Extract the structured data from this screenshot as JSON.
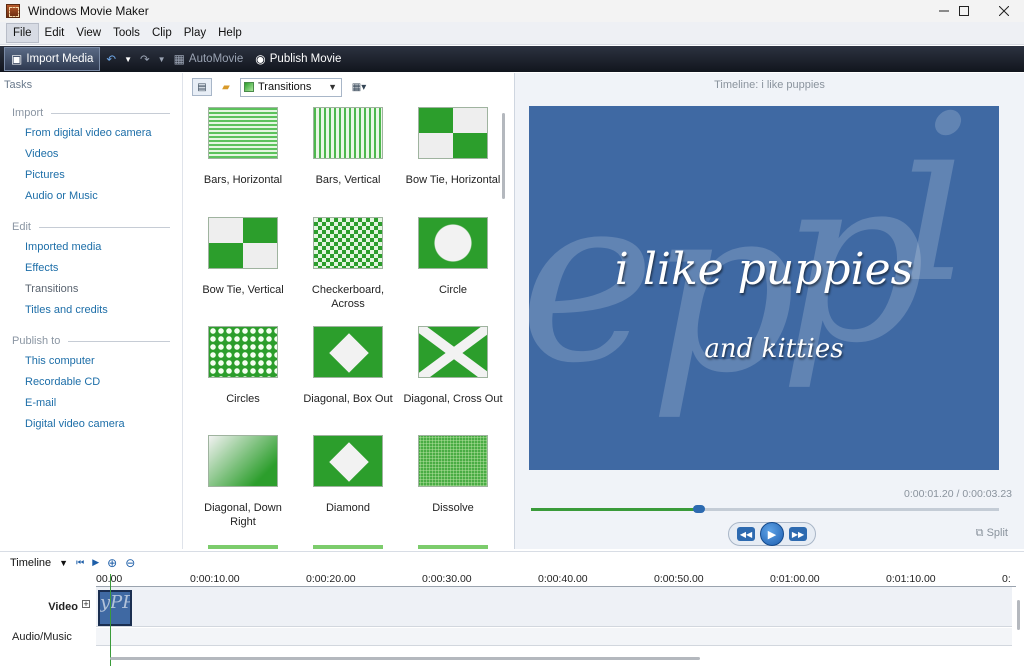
{
  "window": {
    "title": "Windows Movie Maker",
    "controls": [
      "minimize",
      "maximize",
      "close"
    ]
  },
  "menubar": {
    "items": [
      "File",
      "Edit",
      "View",
      "Tools",
      "Clip",
      "Play",
      "Help"
    ],
    "active": "File"
  },
  "toolbar": {
    "import_media": "Import Media",
    "automovie": "AutoMovie",
    "publish_movie": "Publish Movie"
  },
  "tasks": {
    "header": "Tasks",
    "sections": [
      {
        "title": "Import",
        "items": [
          "From digital video camera",
          "Videos",
          "Pictures",
          "Audio or Music"
        ]
      },
      {
        "title": "Edit",
        "items": [
          "Imported media",
          "Effects",
          "Transitions",
          "Titles and credits"
        ]
      },
      {
        "title": "Publish to",
        "items": [
          "This computer",
          "Recordable CD",
          "E-mail",
          "Digital video camera"
        ]
      }
    ],
    "current_item": "Transitions"
  },
  "gallery": {
    "dropdown_value": "Transitions",
    "tiles": [
      {
        "label": "Bars, Horizontal",
        "pattern": "bars-h"
      },
      {
        "label": "Bars, Vertical",
        "pattern": "bars-v"
      },
      {
        "label": "Bow Tie, Horizontal",
        "pattern": "bowtie-h"
      },
      {
        "label": "Bow Tie, Vertical",
        "pattern": "bowtie-v"
      },
      {
        "label": "Checkerboard, Across",
        "pattern": "checker"
      },
      {
        "label": "Circle",
        "pattern": "circle"
      },
      {
        "label": "Circles",
        "pattern": "circles"
      },
      {
        "label": "Diagonal, Box Out",
        "pattern": "box-out"
      },
      {
        "label": "Diagonal, Cross Out",
        "pattern": "cross-out"
      },
      {
        "label": "Diagonal, Down Right",
        "pattern": "down-right"
      },
      {
        "label": "Diamond",
        "pattern": "diamond"
      },
      {
        "label": "Dissolve",
        "pattern": "dissolve"
      }
    ]
  },
  "preview": {
    "title": "Timeline: i like puppies",
    "caption_main": "i like puppies",
    "caption_sub": "and kitties",
    "background_text": "eppi",
    "time_readout": "0:00:01.20 / 0:00:03.23",
    "position_fraction": 0.36,
    "split_label": "Split",
    "video_color": "#3f69a3"
  },
  "timeline": {
    "label": "Timeline",
    "ruler_ticks": [
      "00.00",
      "0:00:10.00",
      "0:00:20.00",
      "0:00:30.00",
      "0:00:40.00",
      "0:00:50.00",
      "0:01:00.00",
      "0:01:10.00",
      "0:"
    ],
    "tracks": [
      "Video",
      "Audio/Music"
    ],
    "clip_text": "yPP"
  },
  "colors": {
    "accent_green": "#3a9b3a",
    "link_blue": "#1d6ea8",
    "transition_green": "#2c9e2c"
  }
}
